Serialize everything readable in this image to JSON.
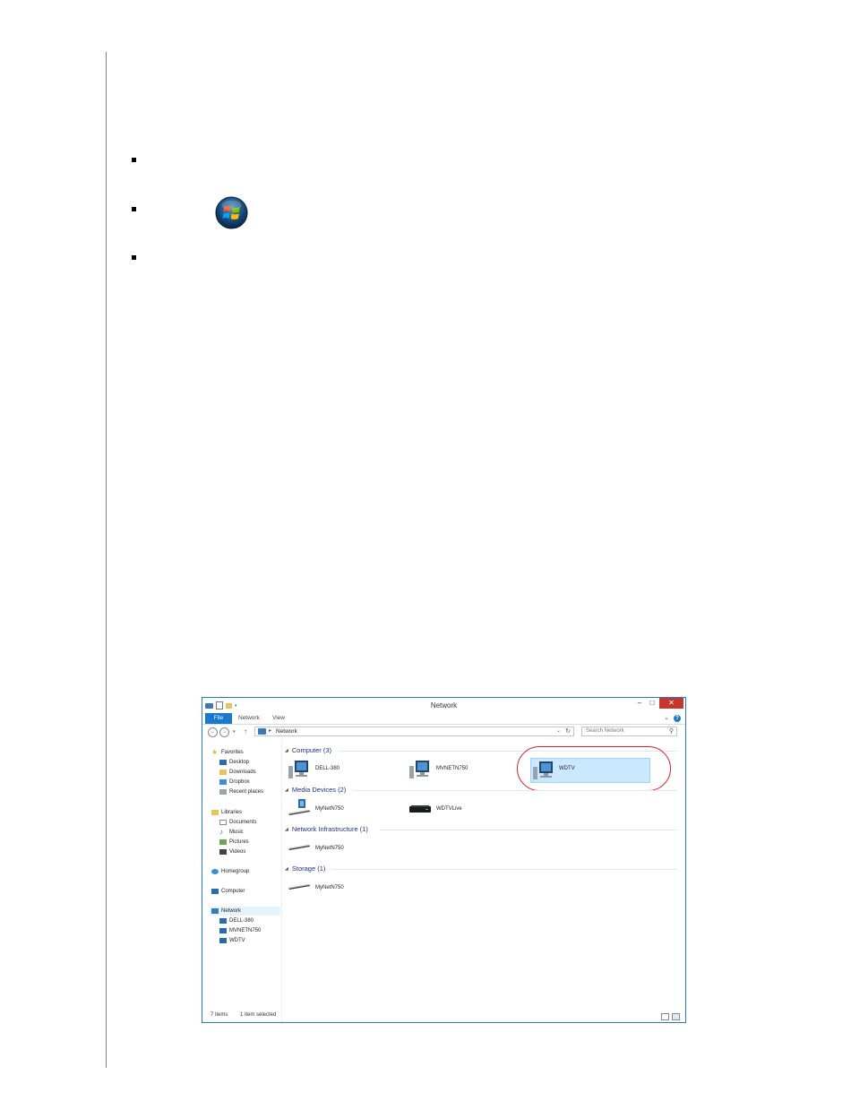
{
  "explorer": {
    "title": "Network",
    "window_controls": {
      "minimize": "–",
      "maximize": "□",
      "close": "✕"
    },
    "ribbon_tabs": [
      "File",
      "Network",
      "View"
    ],
    "address": "Network",
    "search_placeholder": "Search Network",
    "nav": {
      "favorites": {
        "label": "Favorites",
        "items": [
          "Desktop",
          "Downloads",
          "Dropbox",
          "Recent places"
        ]
      },
      "libraries": {
        "label": "Libraries",
        "items": [
          "Documents",
          "Music",
          "Pictures",
          "Videos"
        ]
      },
      "homegroup": "Homegroup",
      "computer": "Computer",
      "network": {
        "label": "Network",
        "items": [
          "DELL-380",
          "MVNETN750",
          "WDTV"
        ]
      }
    },
    "groups": [
      {
        "label": "Computer (3)",
        "items": [
          "DELL-380",
          "MVNETN750",
          "WDTV"
        ]
      },
      {
        "label": "Media Devices (2)",
        "items": [
          "MyNetN750",
          "WDTVLive"
        ]
      },
      {
        "label": "Network Infrastructure (1)",
        "items": [
          "MyNetN750"
        ]
      },
      {
        "label": "Storage (1)",
        "items": [
          "MyNetN750"
        ]
      }
    ],
    "status": {
      "count": "7 items",
      "selection": "1 item selected"
    }
  },
  "colors": {
    "accent": "#1979ca",
    "highlight_ring": "#d4202a",
    "close_button": "#c7362b",
    "group_header": "#1e3287"
  }
}
